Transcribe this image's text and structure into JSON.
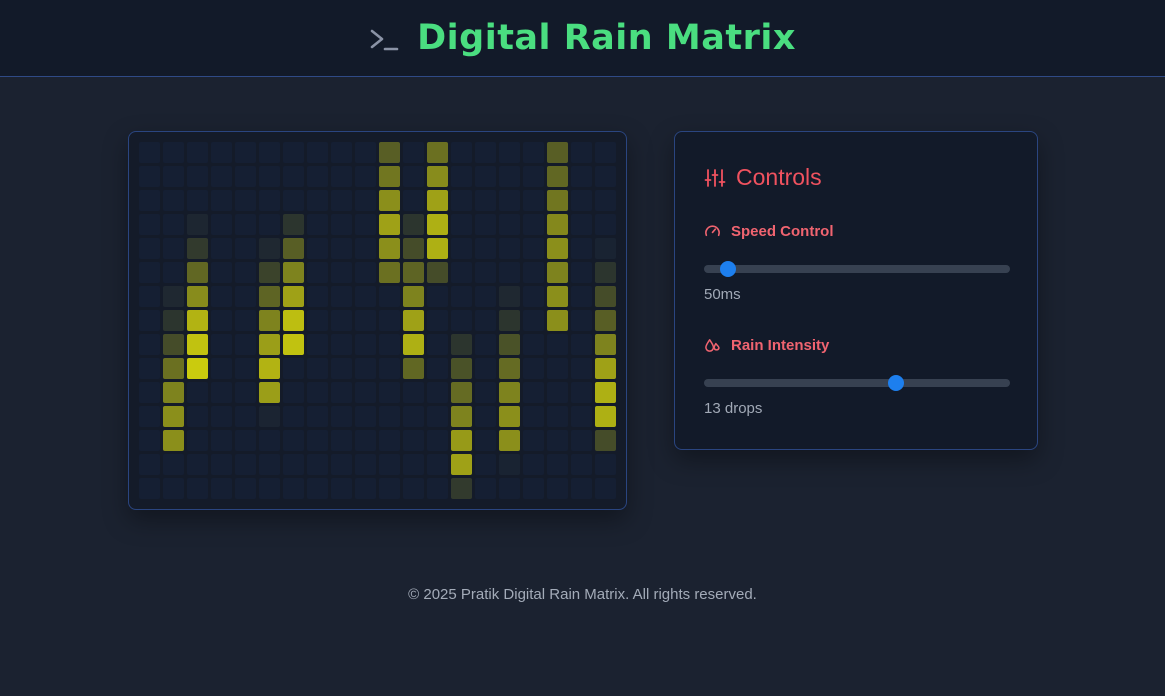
{
  "header": {
    "icon": "terminal-icon",
    "title": "Digital Rain Matrix"
  },
  "matrix": {
    "columns": 20,
    "rows": 15,
    "base_color": "#151f33",
    "lit_color": "#d4d40c",
    "cell_intensity": [
      [
        0,
        0,
        0,
        0,
        0,
        0,
        0,
        0,
        0,
        0,
        0.35,
        0,
        0.45,
        0,
        0,
        0,
        0,
        0.35,
        0,
        0
      ],
      [
        0,
        0,
        0,
        0,
        0,
        0,
        0,
        0,
        0,
        0,
        0.48,
        0,
        0.6,
        0,
        0,
        0,
        0,
        0.4,
        0,
        0
      ],
      [
        0,
        0,
        0,
        0,
        0,
        0,
        0,
        0,
        0,
        0,
        0.62,
        0,
        0.72,
        0,
        0,
        0,
        0,
        0.48,
        0,
        0
      ],
      [
        0,
        0,
        0.04,
        0,
        0,
        0,
        0.12,
        0,
        0,
        0,
        0.72,
        0.12,
        0.8,
        0,
        0,
        0,
        0,
        0.58,
        0,
        0
      ],
      [
        0,
        0,
        0.15,
        0,
        0,
        0.05,
        0.35,
        0,
        0,
        0,
        0.62,
        0.25,
        0.8,
        0,
        0,
        0,
        0,
        0.62,
        0,
        0.02
      ],
      [
        0,
        0,
        0.4,
        0,
        0,
        0.2,
        0.55,
        0,
        0,
        0,
        0.45,
        0.38,
        0.25,
        0,
        0,
        0,
        0,
        0.55,
        0,
        0.12
      ],
      [
        0,
        0.05,
        0.6,
        0,
        0,
        0.38,
        0.72,
        0,
        0,
        0,
        0,
        0.55,
        0,
        0,
        0,
        0.05,
        0,
        0.62,
        0,
        0.25
      ],
      [
        0,
        0.12,
        0.82,
        0,
        0,
        0.55,
        0.88,
        0,
        0,
        0,
        0,
        0.72,
        0,
        0,
        0,
        0.12,
        0,
        0.62,
        0,
        0.35
      ],
      [
        0,
        0.25,
        0.9,
        0,
        0,
        0.7,
        0.9,
        0,
        0,
        0,
        0,
        0.8,
        0,
        0.12,
        0,
        0.28,
        0,
        0,
        0,
        0.55
      ],
      [
        0,
        0.45,
        0.95,
        0,
        0,
        0.82,
        0,
        0,
        0,
        0,
        0,
        0.4,
        0,
        0.28,
        0,
        0.42,
        0,
        0,
        0,
        0.72
      ],
      [
        0,
        0.55,
        0,
        0,
        0,
        0.7,
        0,
        0,
        0,
        0,
        0,
        0,
        0,
        0.42,
        0,
        0.55,
        0,
        0,
        0,
        0.8
      ],
      [
        0,
        0.62,
        0,
        0,
        0,
        0.03,
        0,
        0,
        0,
        0,
        0,
        0,
        0,
        0.55,
        0,
        0.62,
        0,
        0,
        0,
        0.8
      ],
      [
        0,
        0.62,
        0,
        0,
        0,
        0,
        0,
        0,
        0,
        0,
        0,
        0,
        0,
        0.68,
        0,
        0.62,
        0,
        0,
        0,
        0.25
      ],
      [
        0,
        0,
        0,
        0,
        0,
        0,
        0,
        0,
        0,
        0,
        0,
        0,
        0,
        0.72,
        0,
        0.02,
        0,
        0,
        0,
        0
      ],
      [
        0,
        0,
        0,
        0,
        0,
        0,
        0,
        0,
        0,
        0,
        0,
        0,
        0,
        0.15,
        0,
        0,
        0,
        0,
        0,
        0
      ]
    ]
  },
  "controls": {
    "title": "Controls",
    "title_icon": "sliders-icon",
    "speed": {
      "label": "Speed Control",
      "icon": "gauge-icon",
      "value_text": "50ms",
      "position_fraction": 0.08
    },
    "intensity": {
      "label": "Rain Intensity",
      "icon": "droplets-icon",
      "value_text": "13 drops",
      "position_fraction": 0.626
    }
  },
  "footer": {
    "text": "© 2025 Pratik Digital Rain Matrix. All rights reserved."
  },
  "colors": {
    "accent_green": "#4ade80",
    "accent_red": "#f0525f",
    "slider_blue": "#1d7fee",
    "border_blue": "#2a4580"
  }
}
